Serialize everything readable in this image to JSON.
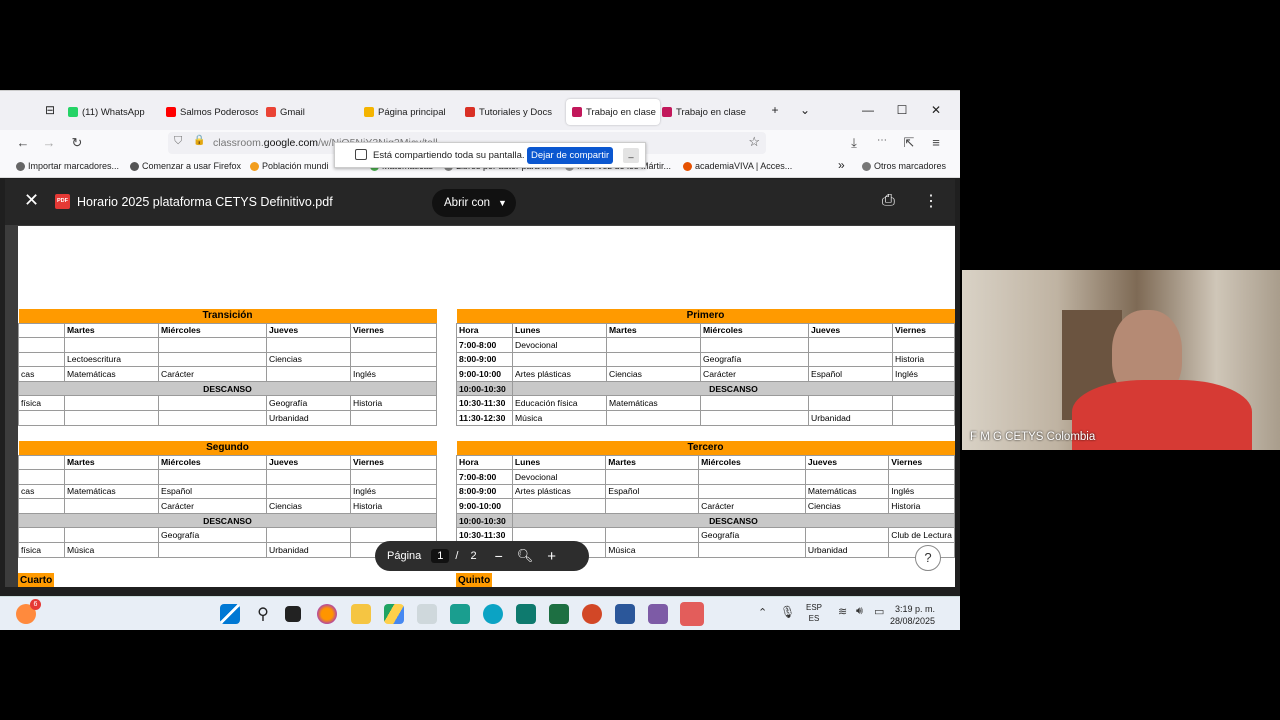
{
  "browser": {
    "tabs": [
      {
        "label": "(11) WhatsApp",
        "color": "#25d366"
      },
      {
        "label": "Salmos Poderosos",
        "color": "#ff0000"
      },
      {
        "label": "Gmail",
        "color": "#ea4335"
      },
      {
        "label": "Página principal",
        "color": "#f4b400"
      },
      {
        "label": "Tutoriales y Docs",
        "color": "#d93025"
      },
      {
        "label": "Trabajo en clase",
        "color": "#c2185b"
      },
      {
        "label": "Trabajo en clase",
        "color": "#c2185b"
      }
    ],
    "url_prefix": "classroom.",
    "url_domain": "google.com",
    "url_rest": "/w/NjQ5NjY3Njg2Mjcy/tall",
    "bookmarks": [
      "Importar marcadores...",
      "Comenzar a usar Firefox",
      "Población mundi",
      "Matemáticas",
      "Libros por autor para l...",
      ":: La Voz de los Mártir...",
      "academiaVIVA | Acces...",
      "Otros marcadores"
    ],
    "share_text": "Está compartiendo toda su pantalla.",
    "share_button": "Dejar de compartir",
    "share_min": "_"
  },
  "viewer": {
    "title": "Horario 2025 plataforma CETYS Definitivo.pdf",
    "open_with": "Abrir con",
    "page_label": "Página",
    "page_current": "1",
    "page_sep": "/",
    "page_total": "2",
    "help": "?"
  },
  "schedule": {
    "left": [
      {
        "grade": "Transición",
        "cols": [
          "",
          "Martes",
          "Miércoles",
          "Jueves",
          "Viernes"
        ],
        "rows": [
          {
            "cells": [
              "",
              "",
              "",
              "",
              ""
            ]
          },
          {
            "cells": [
              "",
              "Lectoescritura",
              "",
              "Ciencias",
              ""
            ]
          },
          {
            "cells": [
              "cas",
              "Matemáticas",
              "Carácter",
              "",
              "Inglés"
            ]
          },
          {
            "descanso": "DESCANSO"
          },
          {
            "cells": [
              "física",
              "",
              "",
              "Geografía",
              "Historia"
            ]
          },
          {
            "cells": [
              "",
              "",
              "",
              "Urbanidad",
              ""
            ]
          }
        ]
      },
      {
        "grade": "Segundo",
        "cols": [
          "",
          "Martes",
          "Miércoles",
          "Jueves",
          "Viernes"
        ],
        "rows": [
          {
            "cells": [
              "",
              "",
              "",
              "",
              ""
            ]
          },
          {
            "cells": [
              "cas",
              "Matemáticas",
              "Español",
              "",
              "Inglés"
            ]
          },
          {
            "cells": [
              "",
              "",
              "Carácter",
              "Ciencias",
              "Historia"
            ]
          },
          {
            "descanso": "DESCANSO"
          },
          {
            "cells": [
              "",
              "",
              "Geografía",
              "",
              ""
            ]
          },
          {
            "cells": [
              "física",
              "Música",
              "",
              "Urbanidad",
              ""
            ]
          }
        ]
      },
      {
        "grade": "Cuarto"
      }
    ],
    "right": [
      {
        "grade": "Primero",
        "cols": [
          "Hora",
          "Lunes",
          "Martes",
          "Miércoles",
          "Jueves",
          "Viernes"
        ],
        "rows": [
          {
            "cells": [
              "7:00-8:00",
              "Devocional",
              "",
              "",
              "",
              ""
            ]
          },
          {
            "cells": [
              "8:00-9:00",
              "",
              "",
              "Geografía",
              "",
              "Historia"
            ]
          },
          {
            "cells": [
              "9:00-10:00",
              "Artes plásticas",
              "Ciencias",
              "Carácter",
              "Español",
              "Inglés"
            ]
          },
          {
            "hora": "10:00-10:30",
            "descanso": "DESCANSO"
          },
          {
            "cells": [
              "10:30-11:30",
              "Educación física",
              "Matemáticas",
              "",
              "",
              ""
            ]
          },
          {
            "cells": [
              "11:30-12:30",
              "Música",
              "",
              "",
              "Urbanidad",
              ""
            ]
          }
        ]
      },
      {
        "grade": "Tercero",
        "cols": [
          "Hora",
          "Lunes",
          "Martes",
          "Miércoles",
          "Jueves",
          "Viernes"
        ],
        "rows": [
          {
            "cells": [
              "7:00-8:00",
              "Devocional",
              "",
              "",
              "",
              ""
            ]
          },
          {
            "cells": [
              "8:00-9:00",
              "Artes plásticas",
              "Español",
              "",
              "Matemáticas",
              "Inglés"
            ]
          },
          {
            "cells": [
              "9:00-10:00",
              "",
              "",
              "Carácter",
              "Ciencias",
              "Historia"
            ]
          },
          {
            "hora": "10:00-10:30",
            "descanso": "DESCANSO"
          },
          {
            "cells": [
              "10:30-11:30",
              "",
              "",
              "Geografía",
              "",
              "Club de Lectura"
            ]
          },
          {
            "cells": [
              "11:30-12:30",
              "",
              "Música",
              "",
              "Urbanidad",
              ""
            ]
          }
        ]
      },
      {
        "grade": "Quinto"
      }
    ]
  },
  "taskbar": {
    "notif_count": "6",
    "lang1": "ESP",
    "lang2": "ES",
    "time": "3:19 p. m.",
    "date": "28/08/2025"
  },
  "webcam": {
    "name": "F M G CETYS Colombia"
  }
}
